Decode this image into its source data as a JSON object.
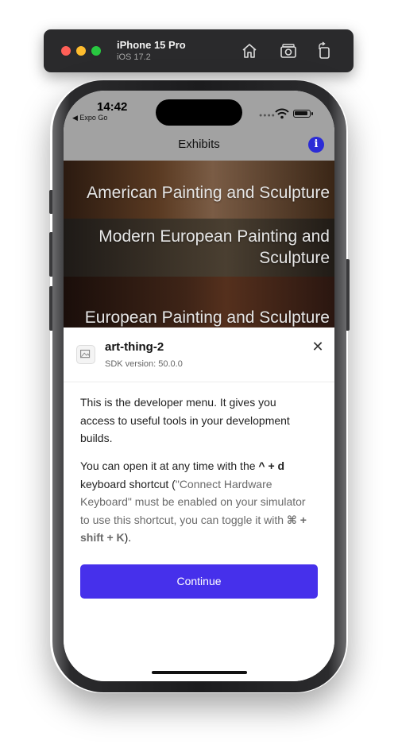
{
  "simulator": {
    "device_name": "iPhone 15 Pro",
    "os_version": "iOS 17.2",
    "icons": [
      "home-icon",
      "screenshot-icon",
      "rotate-icon"
    ],
    "colors": {
      "close": "#ff5f57",
      "minimize": "#febc2e",
      "zoom": "#28c840"
    }
  },
  "status_bar": {
    "time": "14:42",
    "back_label": "◀ Expo Go"
  },
  "nav": {
    "title": "Exhibits",
    "info_icon": "i"
  },
  "exhibits": [
    {
      "label": "American Painting and Sculpture"
    },
    {
      "label": "Modern European Painting and Sculpture"
    },
    {
      "label": "European Painting and Sculpture"
    }
  ],
  "dev_menu": {
    "app_name": "art-thing-2",
    "sdk_version": "SDK version: 50.0.0",
    "close_symbol": "✕",
    "intro": "This is the developer menu. It gives you access to useful tools in your development builds.",
    "open_prefix": "You can open it at any time with the ",
    "open_shortcut": "^ + d",
    "open_middle": " keyboard shortcut (",
    "hardware_note": "\"Connect Hardware Keyboard\" must be enabled on your simulator to use this shortcut, you can toggle it with ",
    "toggle_shortcut": "⌘ + shift + K",
    "open_suffix": ").",
    "continue_label": "Continue",
    "accent": "#4630eb"
  }
}
